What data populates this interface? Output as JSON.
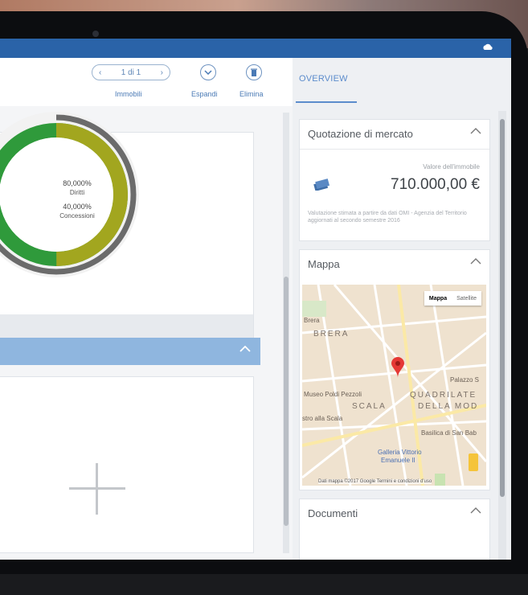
{
  "toolbar": {
    "pager_text": "1 di 1",
    "pager_prev": "‹",
    "pager_next": "›",
    "pager_caption": "Immobili",
    "expand_label": "Espandi",
    "delete_label": "Elimina"
  },
  "donut": {
    "line1_value": "80,000%",
    "line1_label": "Diritti",
    "line2_value": "40,000%",
    "line2_label": "Concessioni",
    "outer_fraction": 0.8,
    "inner_fraction": 0.4,
    "colors": {
      "olive": "#a2a61f",
      "green": "#2f9a3b",
      "gray": "#6b6b6b"
    }
  },
  "right_panel": {
    "tab": "OVERVIEW",
    "market": {
      "title": "Quotazione di mercato",
      "value_label": "Valore dell'immobile",
      "value": "710.000,00 €",
      "note": "Valutazione stimata a partire da dati OMI - Agenzia del Territorio aggiornati al secondo semestre 2016"
    },
    "map": {
      "title": "Mappa",
      "toggle_map": "Mappa",
      "toggle_satellite": "Satellite",
      "labels": {
        "brera_small": "Brera",
        "brera": "BRERA",
        "palazzo": "Palazzo S",
        "museo": "Museo Poldi Pezzoli",
        "quadrilatero": "QUADRILATE",
        "scala": "SCALA",
        "della_moda": "DELLA MOD",
        "alla_scala": "stro alla Scala",
        "basilica": "Basilica di San Bab",
        "galleria": "Galleria Vittorio",
        "emanuele": "Emanuele II"
      },
      "attribution": "Dati mappa ©2017 Google   Termini e condizioni d'uso"
    },
    "documents": {
      "title": "Documenti"
    }
  },
  "colors": {
    "brand_blue": "#2a63a8",
    "accent": "#5c8ccc"
  }
}
